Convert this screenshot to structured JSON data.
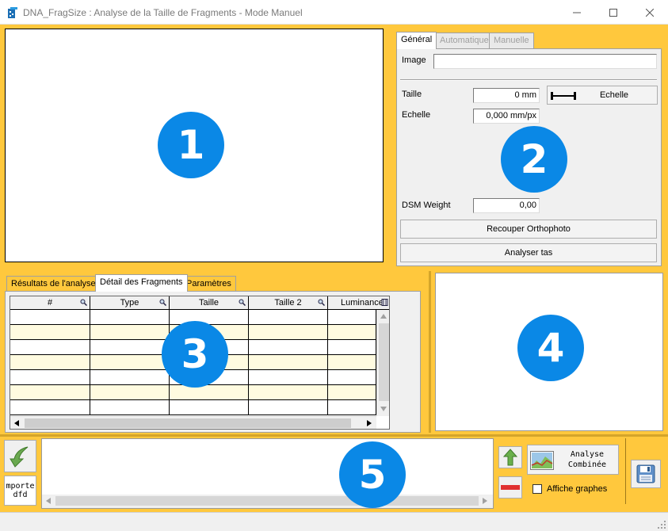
{
  "window": {
    "title": "DNA_FragSize : Analyse de la Taille de Fragments - Mode Manuel",
    "minimize": "—",
    "maximize": "☐",
    "close": "✕"
  },
  "badges": {
    "b1": "1",
    "b2": "2",
    "b3": "3",
    "b4": "4",
    "b5": "5"
  },
  "right_panel": {
    "tabs": [
      "Général",
      "Automatique",
      "Manuelle"
    ],
    "image_label": "Image",
    "image_value": "",
    "taille_label": "Taille",
    "taille_value": "0 mm",
    "echelle_button": "Echelle",
    "echelle_label": "Echelle",
    "echelle_value": "0,000 mm/px",
    "dsm_label": "DSM Weight",
    "dsm_value": "0,00",
    "recouper_button": "Recouper Orthophoto",
    "analyser_button": "Analyser tas"
  },
  "results_panel": {
    "tabs": [
      "Résultats de l'analyse",
      "Détail des Fragments",
      "Paramètres"
    ],
    "columns": [
      "#",
      "Type",
      "Taille",
      "Taille 2",
      "Luminance"
    ],
    "row_count": 7
  },
  "bottom_bar": {
    "import_label_1": "mporte",
    "import_label_2": "dfd",
    "analyse_label_1": "Analyse",
    "analyse_label_2": "Combinée",
    "affiche_label": "Affiche graphes",
    "affiche_checked": false
  },
  "colors": {
    "frame": "#ffc83d",
    "badge": "#0a88e6",
    "row_alt": "#fffbe0"
  }
}
